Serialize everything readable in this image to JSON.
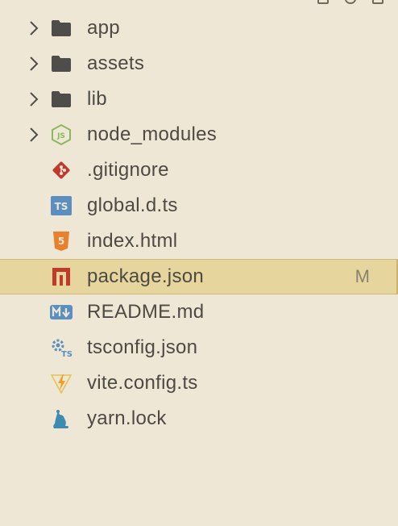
{
  "explorer": {
    "items": [
      {
        "label": "app",
        "kind": "folder",
        "icon": "folder-icon"
      },
      {
        "label": "assets",
        "kind": "folder",
        "icon": "folder-icon"
      },
      {
        "label": "lib",
        "kind": "folder",
        "icon": "folder-icon"
      },
      {
        "label": "node_modules",
        "kind": "folder",
        "icon": "nodejs-icon"
      },
      {
        "label": ".gitignore",
        "kind": "file",
        "icon": "git-icon"
      },
      {
        "label": "global.d.ts",
        "kind": "file",
        "icon": "typescript-icon"
      },
      {
        "label": "index.html",
        "kind": "file",
        "icon": "html5-icon"
      },
      {
        "label": "package.json",
        "kind": "file",
        "icon": "npm-icon",
        "badge": "M",
        "selected": true
      },
      {
        "label": "README.md",
        "kind": "file",
        "icon": "markdown-icon"
      },
      {
        "label": "tsconfig.json",
        "kind": "file",
        "icon": "tsconfig-icon"
      },
      {
        "label": "vite.config.ts",
        "kind": "file",
        "icon": "vite-icon"
      },
      {
        "label": "yarn.lock",
        "kind": "file",
        "icon": "yarn-icon"
      }
    ]
  },
  "colors": {
    "background": "#efe7d5",
    "selected_row": "#e6d69d",
    "text": "#4d4a44",
    "folder": "#4f4d49",
    "git": "#c0392b",
    "typescript": "#5a8fbf",
    "html5": "#e8802e",
    "npm": "#c0392b",
    "markdown": "#5a8fbf",
    "node": "#8cb85c",
    "yarn": "#3d8bb1"
  }
}
